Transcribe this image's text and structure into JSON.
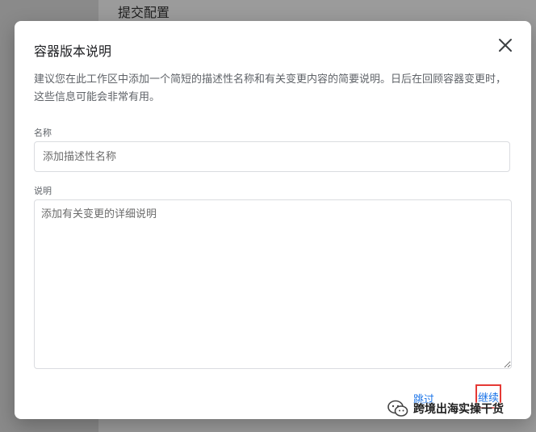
{
  "background": {
    "title": "提交配置"
  },
  "dialog": {
    "title": "容器版本说明",
    "description": "建议您在此工作区中添加一个简短的描述性名称和有关变更内容的简要说明。日后在回顾容器变更时，这些信息可能会非常有用。",
    "name_label": "名称",
    "name_placeholder": "添加描述性名称",
    "desc_label": "说明",
    "desc_placeholder": "添加有关变更的详细说明",
    "skip_label": "跳过",
    "continue_label": "继续"
  },
  "watermark": {
    "text": "跨境出海实操干货"
  },
  "colors": {
    "accent": "#1a73e8",
    "highlight": "#e53935"
  },
  "icons": {
    "close": "close-icon",
    "watermark": "wechat-logo-icon"
  }
}
